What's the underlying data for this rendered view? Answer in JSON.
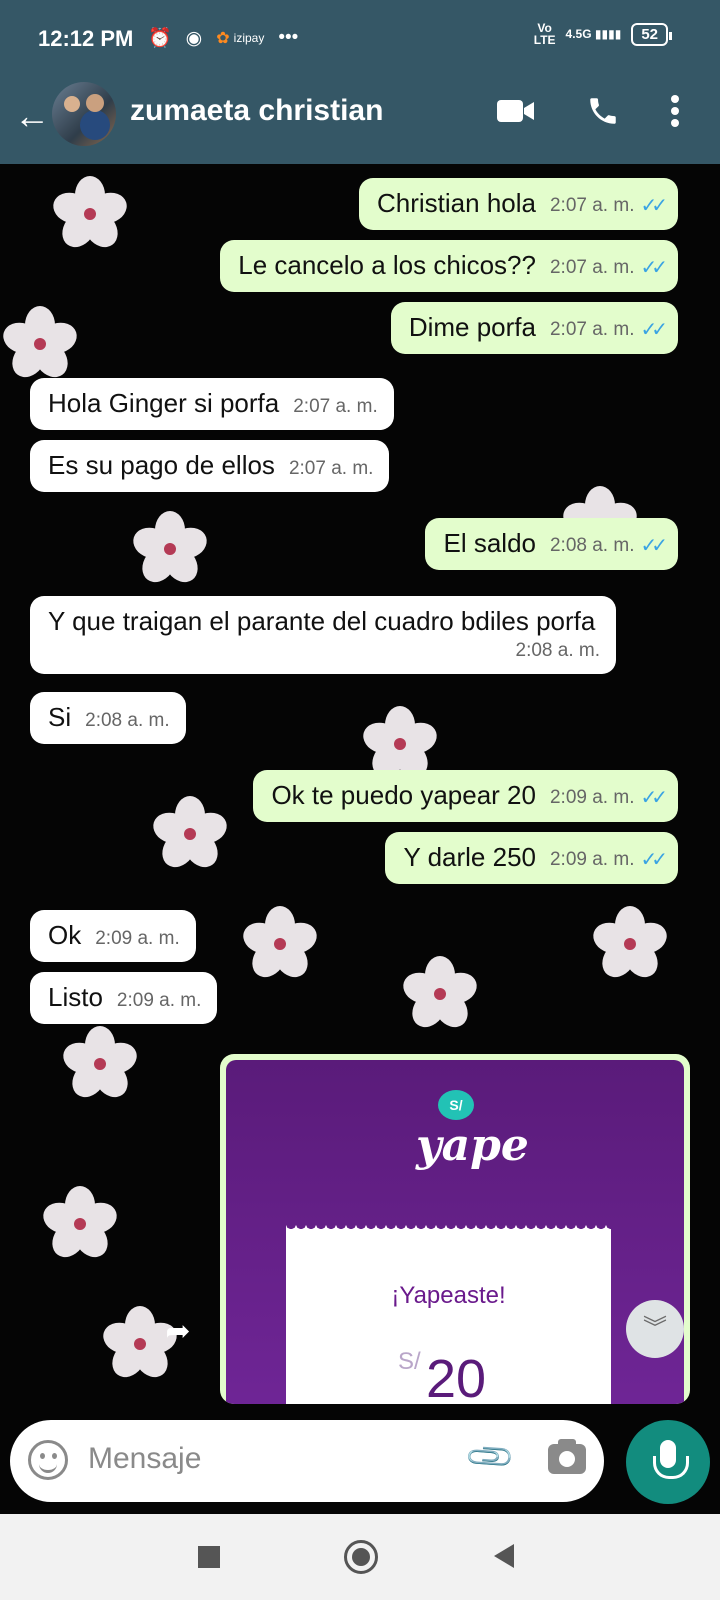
{
  "status": {
    "time": "12:12 PM",
    "notif_app": "izipay",
    "more": "•••",
    "net_vo": "Vo",
    "net_lte": "LTE",
    "net_gen": "4.5G",
    "battery": "52"
  },
  "header": {
    "contact_name": "zumaeta christian"
  },
  "messages": [
    {
      "dir": "out",
      "text": "Christian hola",
      "time": "2:07 a. m."
    },
    {
      "dir": "out",
      "text": "Le cancelo a los chicos??",
      "time": "2:07 a. m."
    },
    {
      "dir": "out",
      "text": "Dime porfa",
      "time": "2:07 a. m."
    },
    {
      "dir": "in",
      "text": "Hola Ginger si porfa",
      "time": "2:07 a. m."
    },
    {
      "dir": "in",
      "text": "Es su pago de ellos",
      "time": "2:07 a. m."
    },
    {
      "dir": "out",
      "text": "El saldo",
      "time": "2:08 a. m."
    },
    {
      "dir": "in",
      "text": "Y que traigan el parante del cuadro bdiles porfa",
      "time": "2:08 a. m."
    },
    {
      "dir": "in",
      "text": "Si",
      "time": "2:08 a. m."
    },
    {
      "dir": "out",
      "text": "Ok te puedo yapear 20",
      "time": "2:09 a. m."
    },
    {
      "dir": "out",
      "text": "Y darle 250",
      "time": "2:09 a. m."
    },
    {
      "dir": "in",
      "text": "Ok",
      "time": "2:09 a. m."
    },
    {
      "dir": "in",
      "text": "Listo",
      "time": "2:09 a. m."
    }
  ],
  "yape": {
    "badge": "S/",
    "logo": "yape",
    "title": "¡Yapeaste!",
    "currency": "S/",
    "amount": "20"
  },
  "input": {
    "placeholder": "Mensaje"
  },
  "tick_symbol": "✓✓"
}
